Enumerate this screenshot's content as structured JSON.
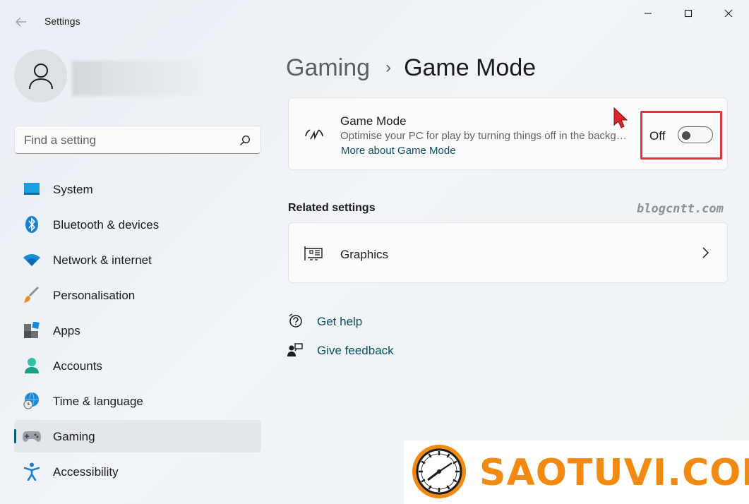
{
  "window": {
    "title": "Settings",
    "controls": [
      "minimize",
      "maximize",
      "close"
    ]
  },
  "search": {
    "placeholder": "Find a setting"
  },
  "sidebar": {
    "items": [
      {
        "label": "System",
        "icon": "system-icon"
      },
      {
        "label": "Bluetooth & devices",
        "icon": "bluetooth-icon"
      },
      {
        "label": "Network & internet",
        "icon": "wifi-icon"
      },
      {
        "label": "Personalisation",
        "icon": "brush-icon"
      },
      {
        "label": "Apps",
        "icon": "apps-icon"
      },
      {
        "label": "Accounts",
        "icon": "accounts-icon"
      },
      {
        "label": "Time & language",
        "icon": "globe-clock-icon"
      },
      {
        "label": "Gaming",
        "icon": "gamepad-icon",
        "active": true
      },
      {
        "label": "Accessibility",
        "icon": "accessibility-icon"
      }
    ]
  },
  "breadcrumb": {
    "parent": "Gaming",
    "separator": "›",
    "current": "Game Mode"
  },
  "game_mode": {
    "title": "Game Mode",
    "description": "Optimise your PC for play by turning things off in the background",
    "link": "More about Game Mode",
    "toggle_label": "Off",
    "toggle_on": false
  },
  "related": {
    "title": "Related settings",
    "watermark": "blogcntt.com",
    "graphics_label": "Graphics"
  },
  "help": {
    "get_help": "Get help",
    "give_feedback": "Give feedback"
  },
  "logo": {
    "text": "SAOTUVI.COM"
  },
  "colors": {
    "accent": "#0d5a6e",
    "link": "#0a4f63",
    "highlight": "#d9363e",
    "logo_orange": "#f28a12"
  }
}
